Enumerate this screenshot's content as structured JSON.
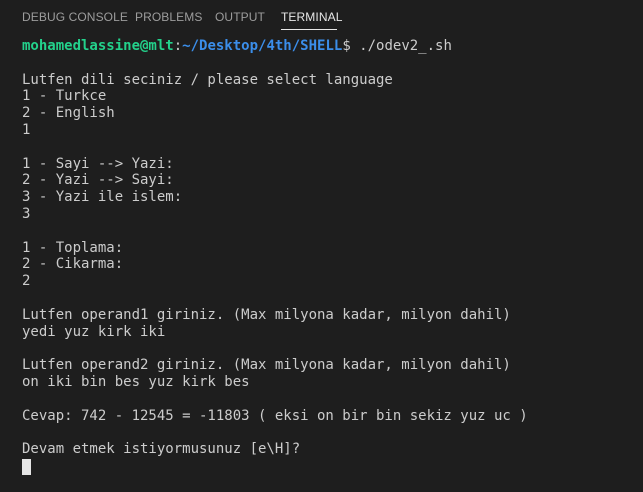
{
  "tabs": [
    {
      "label": "DEBUG CONSOLE"
    },
    {
      "label": "PROBLEMS"
    },
    {
      "label": "OUTPUT"
    },
    {
      "label": "TERMINAL"
    }
  ],
  "active_tab": "TERMINAL",
  "prompt": {
    "user_host": "mohamedlassine@mlt",
    "separator": ":",
    "path": "~/Desktop/4th/SHELL",
    "symbol": "$",
    "command": " ./odev2_.sh"
  },
  "lines": [
    "",
    "Lutfen dili seciniz / please select language",
    "1 - Turkce",
    "2 - English",
    "1",
    "",
    "1 - Sayi --> Yazi:",
    "2 - Yazi --> Sayi:",
    "3 - Yazi ile islem:",
    "3",
    "",
    "1 - Toplama:",
    "2 - Cikarma:",
    "2",
    "",
    "Lutfen operand1 giriniz. (Max milyona kadar, milyon dahil)",
    "yedi yuz kirk iki",
    "",
    "Lutfen operand2 giriniz. (Max milyona kadar, milyon dahil)",
    "on iki bin bes yuz kirk bes",
    "",
    "Cevap: 742 - 12545 = -11803 ( eksi on bir bin sekiz yuz uc )",
    "",
    "Devam etmek istiyormusunuz [e\\H]?"
  ],
  "colors": {
    "background": "#1e1e1e",
    "text": "#cccccc",
    "user_host": "#23d18b",
    "path": "#3b8eea",
    "tab_inactive": "#9d9d9d",
    "tab_active": "#e7e7e7",
    "cursor": "#e5e5e5"
  }
}
